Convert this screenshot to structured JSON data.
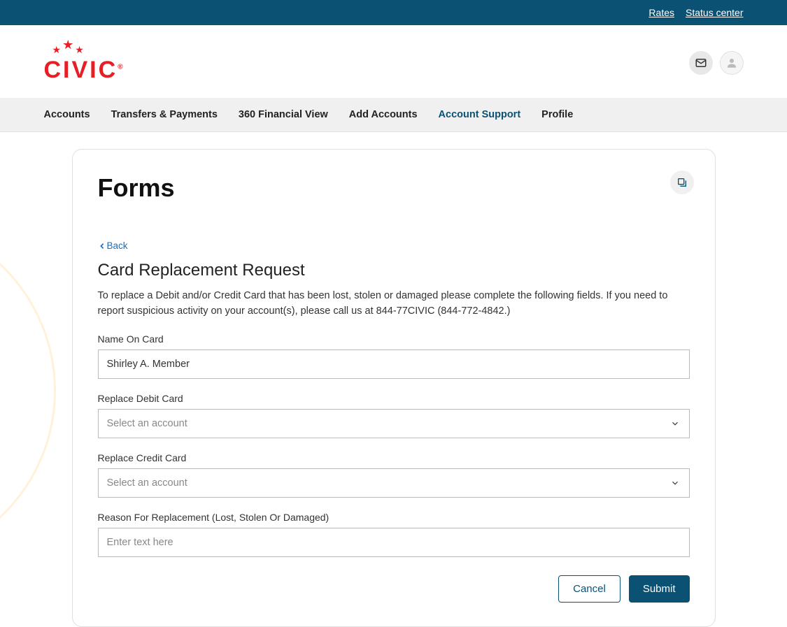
{
  "topbar": {
    "rates": "Rates",
    "status_center": "Status center"
  },
  "logo": {
    "text": "CIVIC"
  },
  "nav": {
    "items": [
      {
        "label": "Accounts"
      },
      {
        "label": "Transfers & Payments"
      },
      {
        "label": "360 Financial View"
      },
      {
        "label": "Add Accounts"
      },
      {
        "label": "Account Support"
      },
      {
        "label": "Profile"
      }
    ]
  },
  "page": {
    "title": "Forms",
    "back": "Back",
    "subtitle": "Card Replacement Request",
    "description": "To replace a Debit and/or Credit Card that has been lost, stolen or damaged please complete the following fields. If you need to report suspicious activity on your account(s), please call us at 844-77CIVIC (844-772-4842.)"
  },
  "form": {
    "name_label": "Name On Card",
    "name_value": "Shirley A. Member",
    "debit_label": "Replace Debit Card",
    "debit_placeholder": "Select an account",
    "credit_label": "Replace Credit Card",
    "credit_placeholder": "Select an account",
    "reason_label": "Reason For Replacement (Lost, Stolen Or Damaged)",
    "reason_placeholder": "Enter text here"
  },
  "buttons": {
    "cancel": "Cancel",
    "submit": "Submit"
  }
}
